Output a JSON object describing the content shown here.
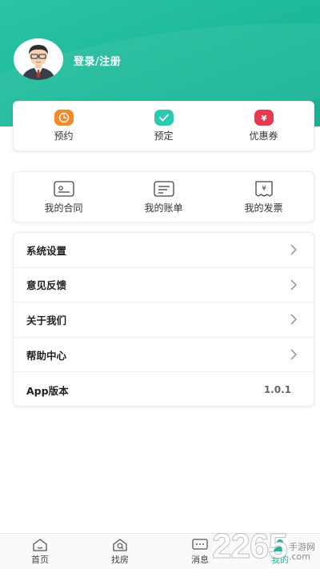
{
  "profile": {
    "login_label": "登录/注册"
  },
  "quick_actions": [
    {
      "label": "预约",
      "icon": "clock-icon",
      "color": "#f08a2a"
    },
    {
      "label": "预定",
      "icon": "check-icon",
      "color": "#2bc9ae"
    },
    {
      "label": "优惠券",
      "icon": "coupon-icon",
      "color": "#e83a4e"
    }
  ],
  "documents": [
    {
      "label": "我的合同",
      "icon": "contract-icon"
    },
    {
      "label": "我的账单",
      "icon": "bill-icon"
    },
    {
      "label": "我的发票",
      "icon": "invoice-icon"
    }
  ],
  "menu": [
    {
      "label": "系统设置"
    },
    {
      "label": "意见反馈"
    },
    {
      "label": "关于我们"
    },
    {
      "label": "帮助中心"
    },
    {
      "label": "App版本",
      "value": "1.0.1"
    }
  ],
  "tabs": [
    {
      "label": "首页",
      "icon": "home-icon"
    },
    {
      "label": "找房",
      "icon": "house-search-icon"
    },
    {
      "label": "消息",
      "icon": "message-icon"
    },
    {
      "label": "我的",
      "icon": "user-icon",
      "active": true
    }
  ],
  "watermark": {
    "number": "2265",
    "text1": "手游网",
    "text2": ".com"
  },
  "colors": {
    "brand": "#1cb89a"
  }
}
